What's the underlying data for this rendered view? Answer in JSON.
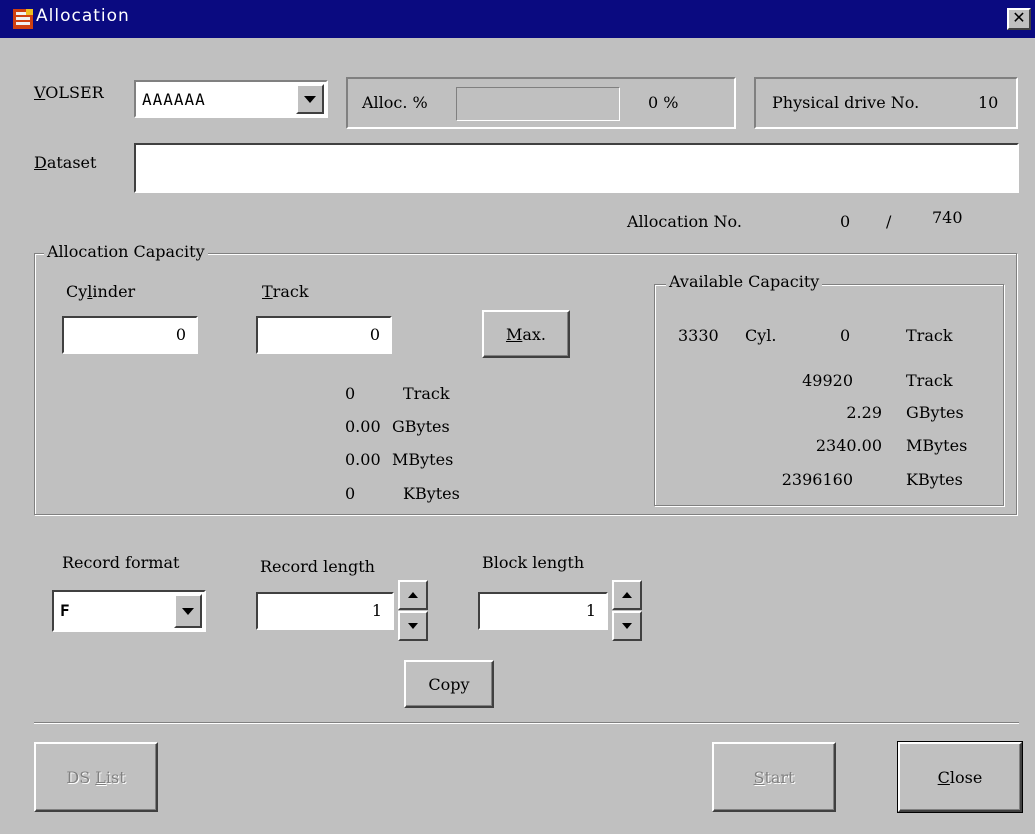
{
  "window": {
    "title": "Allocation",
    "close_glyph": "✕"
  },
  "volser": {
    "label_prefix": "V",
    "label_rest": "OLSER",
    "value": "AAAAAA"
  },
  "alloc_pct": {
    "label": "Alloc. %",
    "value": "0 %",
    "progress": 0
  },
  "physical_drive": {
    "label": "Physical drive No.",
    "value": "10"
  },
  "dataset": {
    "label_prefix": "D",
    "label_rest": "ataset",
    "value": ""
  },
  "allocation_no": {
    "label": "Allocation No.",
    "current": "0",
    "sep": "/",
    "total": "740"
  },
  "allocation_capacity": {
    "title": "Allocation Capacity",
    "cylinder_label_prefix": "Cy",
    "cylinder_label_u": "l",
    "cylinder_label_rest": "inder",
    "cylinder_value": "0",
    "track_label_prefix": "T",
    "track_label_rest": "rack",
    "track_value": "0",
    "max_button_prefix": "M",
    "max_button_rest": "ax.",
    "summary": [
      {
        "value": "0",
        "unit": "Track"
      },
      {
        "value": "0.00",
        "unit": "GBytes"
      },
      {
        "value": "0.00",
        "unit": "MBytes"
      },
      {
        "value": "0",
        "unit": "KBytes"
      }
    ]
  },
  "available_capacity": {
    "title": "Available Capacity",
    "cyl_value": "3330",
    "cyl_unit": "Cyl.",
    "track_value": "0",
    "track_unit": "Track",
    "rows": [
      {
        "value": "49920",
        "unit": "Track"
      },
      {
        "value": "2.29",
        "unit": "GBytes"
      },
      {
        "value": "2340.00",
        "unit": "MBytes"
      },
      {
        "value": "2396160",
        "unit": "KBytes"
      }
    ]
  },
  "record_format": {
    "label": "Record format",
    "value": "F"
  },
  "record_length": {
    "label": "Record length",
    "value": "1"
  },
  "block_length": {
    "label": "Block length",
    "value": "1"
  },
  "buttons": {
    "copy": "Copy",
    "ds_list_prefix": "DS ",
    "ds_list_u": "L",
    "ds_list_rest": "ist",
    "start_prefix": "S",
    "start_rest": "tart",
    "close_prefix": "C",
    "close_rest": "lose"
  }
}
